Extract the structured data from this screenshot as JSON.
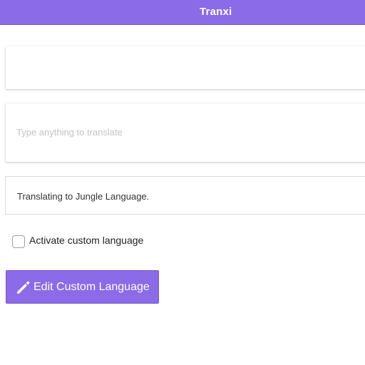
{
  "header": {
    "title": "Tranxi"
  },
  "input": {
    "placeholder": "Type anything to translate",
    "value": ""
  },
  "status": {
    "text": "Translating to Jungle Language."
  },
  "custom_language": {
    "checkbox_label": "Activate custom language",
    "checked": false
  },
  "edit_button": {
    "label": "Edit Custom Language",
    "icon": "pencil-icon"
  },
  "colors": {
    "accent": "#8b6be8"
  }
}
